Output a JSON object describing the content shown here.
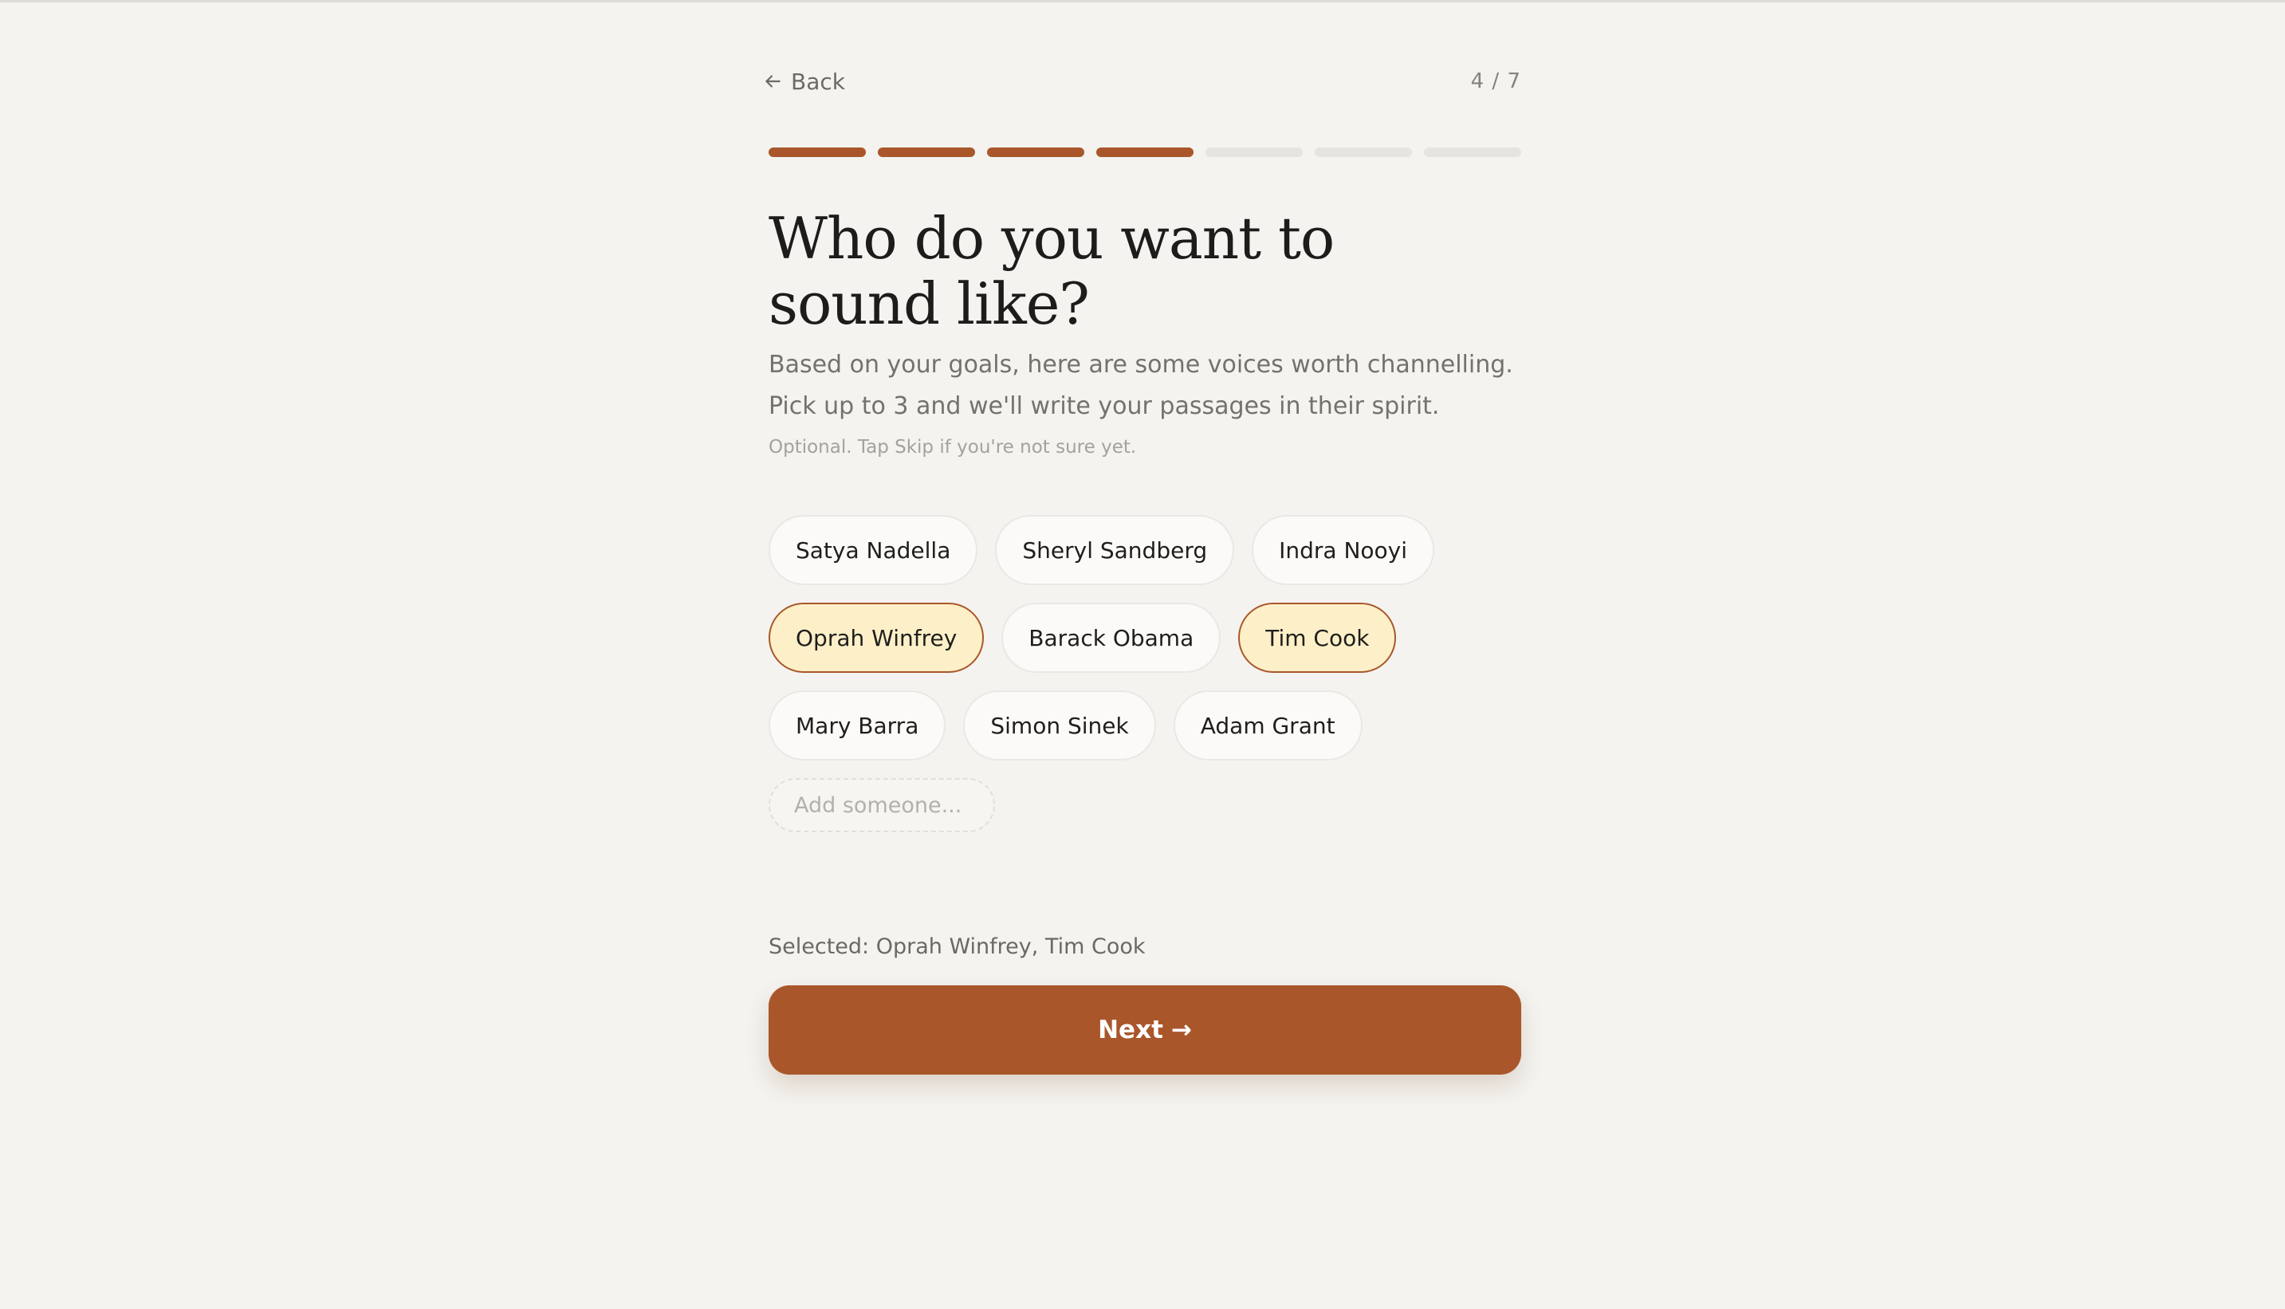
{
  "header": {
    "back_label": "Back",
    "step_counter": "4 / 7"
  },
  "progress": {
    "total_steps": 7,
    "completed_steps": 4,
    "accent_color": "#a9572a",
    "track_color": "#e6e4e0"
  },
  "main": {
    "title": "Who do you want to sound like?",
    "subtitle": "Based on your goals, here are some voices worth channelling. Pick up to 3 and we'll write your passages in their spirit.",
    "hint": "Optional. Tap Skip if you're not sure yet."
  },
  "voices": [
    {
      "name": "Satya Nadella",
      "selected": false
    },
    {
      "name": "Sheryl Sandberg",
      "selected": false
    },
    {
      "name": "Indra Nooyi",
      "selected": false
    },
    {
      "name": "Oprah Winfrey",
      "selected": true
    },
    {
      "name": "Barack Obama",
      "selected": false
    },
    {
      "name": "Tim Cook",
      "selected": true
    },
    {
      "name": "Mary Barra",
      "selected": false
    },
    {
      "name": "Simon Sinek",
      "selected": false
    },
    {
      "name": "Adam Grant",
      "selected": false
    }
  ],
  "add_someone": {
    "placeholder": "Add someone..."
  },
  "footer": {
    "selected_text": "Selected: Oprah Winfrey, Tim Cook",
    "next_label": "Next",
    "next_arrow": "→",
    "next_color": "#a9572a"
  },
  "icons": {
    "back": "arrow-left-icon",
    "next": "arrow-right-icon"
  }
}
